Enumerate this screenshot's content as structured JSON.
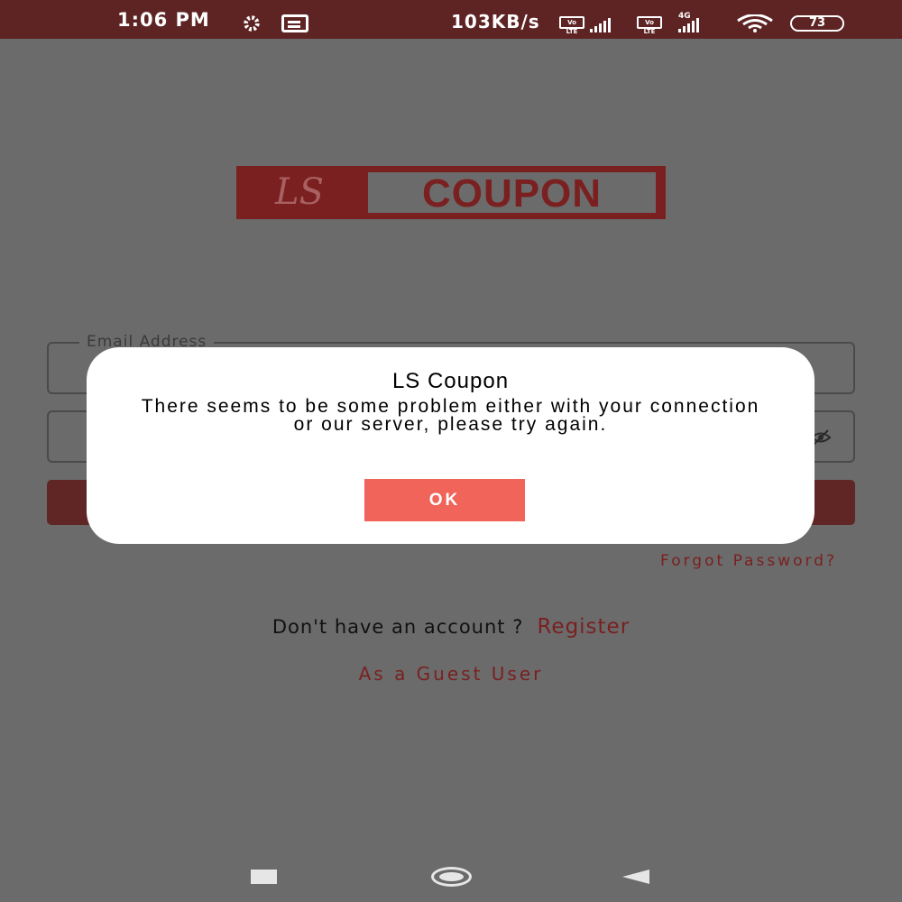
{
  "status_bar": {
    "time": "1:06 PM",
    "network_speed": "103KB/s",
    "volte_label": "Vo LTE",
    "network_type": "4G",
    "battery": "73",
    "icons": [
      "gear-icon",
      "notification-icon",
      "signal-icon",
      "wifi-icon",
      "battery-icon"
    ]
  },
  "logo": {
    "left_text": "LS",
    "right_text": "COUPON"
  },
  "form": {
    "email_label": "Email Address",
    "forgot_password": "Forgot Password?",
    "no_account_text": "Don't have an account ?",
    "register_link": "Register",
    "guest_link": "As a Guest User"
  },
  "dialog": {
    "title": "LS Coupon",
    "message": "There seems to be some problem either with your connection or our server, please try again.",
    "ok_label": "OK"
  },
  "nav_bar": {
    "icons": [
      "recents-icon",
      "home-icon",
      "back-icon"
    ]
  },
  "colors": {
    "status_bar": "#5e2424",
    "overlay": "#6b6b6b",
    "brand": "#7a2020",
    "ok_button": "#f0645a"
  }
}
